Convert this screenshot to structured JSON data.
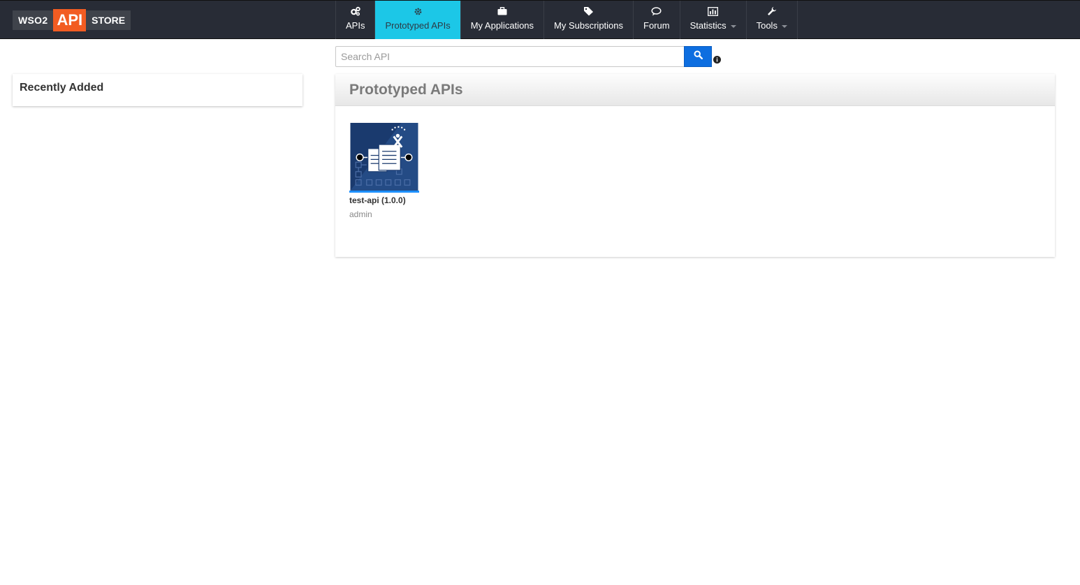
{
  "brand": {
    "left": "WSO2",
    "middle": "API",
    "right": "STORE",
    "colors": {
      "topbar": "#282c36",
      "accent": "#f25c22",
      "active_tab": "#1cc7e7",
      "search_button": "#0d6ee0"
    }
  },
  "nav": {
    "items": [
      {
        "label": "APIs",
        "icon": "gears-icon",
        "active": false,
        "dropdown": false
      },
      {
        "label": "Prototyped APIs",
        "icon": "gear-icon",
        "active": true,
        "dropdown": false
      },
      {
        "label": "My Applications",
        "icon": "briefcase-icon",
        "active": false,
        "dropdown": false
      },
      {
        "label": "My Subscriptions",
        "icon": "tags-icon",
        "active": false,
        "dropdown": false
      },
      {
        "label": "Forum",
        "icon": "speech-bubble-icon",
        "active": false,
        "dropdown": false
      },
      {
        "label": "Statistics",
        "icon": "bar-chart-icon",
        "active": false,
        "dropdown": true
      },
      {
        "label": "Tools",
        "icon": "wrench-icon",
        "active": false,
        "dropdown": true
      }
    ]
  },
  "search": {
    "placeholder": "Search API",
    "value": "",
    "button_icon": "search-icon",
    "help_icon": "info-icon"
  },
  "sidebar": {
    "recently_added_title": "Recently Added"
  },
  "main": {
    "title": "Prototyped APIs",
    "apis": [
      {
        "name": "test-api (1.0.0)",
        "owner": "admin",
        "thumbnail_icon": "api-document-icon"
      }
    ]
  }
}
